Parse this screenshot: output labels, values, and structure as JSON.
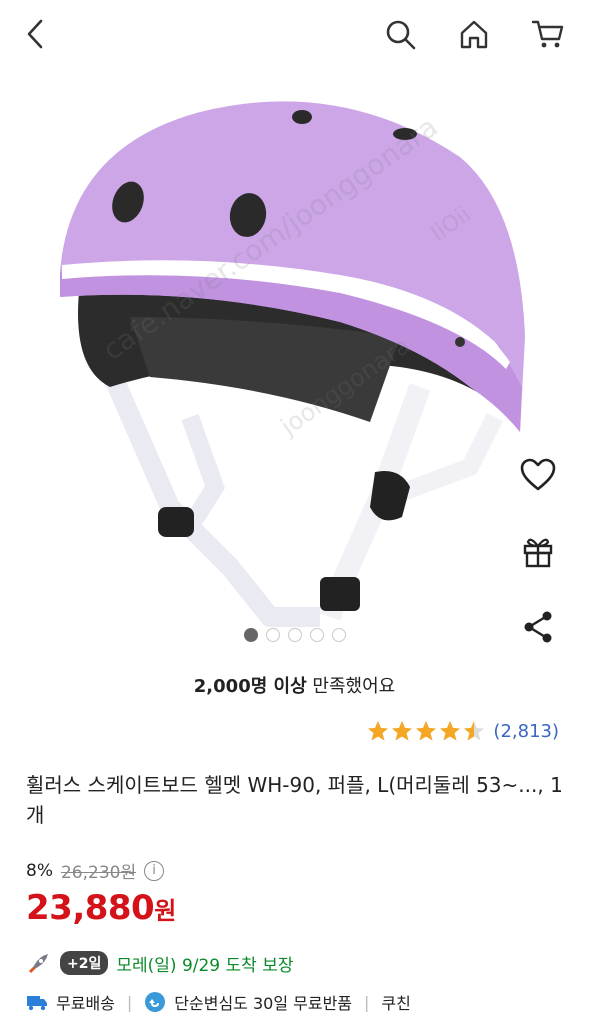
{
  "header": {
    "back": "back-icon",
    "search": "search-icon",
    "home": "home-icon",
    "cart": "cart-icon"
  },
  "image": {
    "watermarks": [
      "cafe.naver.com/joonggonara",
      "joonggonara",
      "IiOii"
    ],
    "page_count": 5,
    "active_page": 1
  },
  "side_actions": [
    "heart-icon",
    "gift-icon",
    "share-icon"
  ],
  "satisfaction": {
    "bold": "2,000명 이상",
    "rest": " 만족했어요"
  },
  "rating": {
    "stars": 4.5,
    "count": "(2,813)"
  },
  "product": {
    "title": "휠러스 스케이트보드 헬멧 WH-90, 퍼플, L(머리둘레 53~..., 1개",
    "discount": "8%",
    "original_price": "26,230원",
    "info": "i",
    "price": "23,880",
    "price_unit": "원"
  },
  "delivery": {
    "badge": "+2일",
    "text": "모레(일) 9/29 도착 보장"
  },
  "benefits": {
    "free_shipping": "무료배송",
    "free_return": "단순변심도 30일 무료반품",
    "coupon": "쿠친"
  },
  "colors": {
    "helmet": "#cda6e8",
    "price": "#d3121a",
    "delivery": "#0a8a2a",
    "rating_link": "#3a66c4",
    "star": "#f5a623"
  }
}
